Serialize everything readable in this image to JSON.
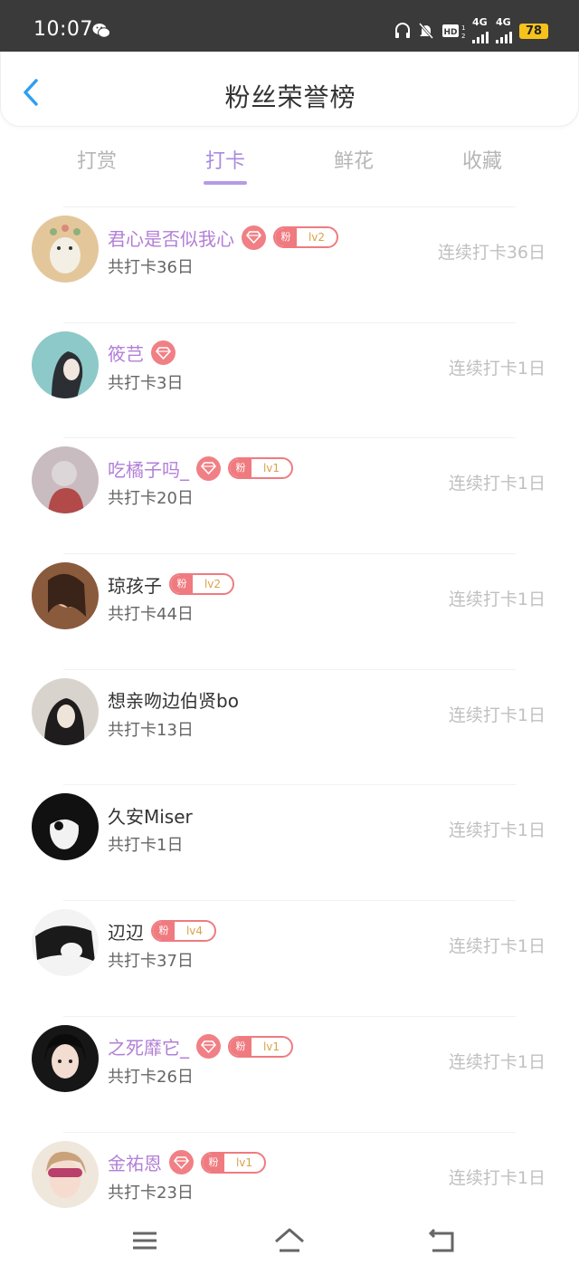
{
  "status_bar": {
    "time": "10:07",
    "net1": "4G",
    "net2": "4G",
    "hd": "HD",
    "battery": "78",
    "icons": [
      "wechat-icon",
      "headphones-icon",
      "mute-icon",
      "hd-icon",
      "signal-icon",
      "battery-icon"
    ]
  },
  "header": {
    "title": "粉丝荣誉榜",
    "back_icon": "chevron-left-icon"
  },
  "tabs": [
    {
      "label": "打赏",
      "active": false
    },
    {
      "label": "打卡",
      "active": true
    },
    {
      "label": "鲜花",
      "active": false
    },
    {
      "label": "收藏",
      "active": false
    }
  ],
  "colors": {
    "accent": "#a98be0",
    "vip_name": "#b27fd6",
    "badge": "#ef7b80",
    "level_text": "#d9a24a"
  },
  "fans": [
    {
      "name": "君心是否似我心",
      "vip": true,
      "gem": true,
      "fan_tag": "粉",
      "level": "lv2",
      "total": "共打卡36日",
      "streak": "连续打卡36日"
    },
    {
      "name": "筱芑",
      "vip": true,
      "gem": true,
      "fan_tag": "",
      "level": "",
      "total": "共打卡3日",
      "streak": "连续打卡1日"
    },
    {
      "name": "吃橘子吗_",
      "vip": true,
      "gem": true,
      "fan_tag": "粉",
      "level": "lv1",
      "total": "共打卡20日",
      "streak": "连续打卡1日"
    },
    {
      "name": "琼孩子",
      "vip": false,
      "gem": false,
      "fan_tag": "粉",
      "level": "lv2",
      "total": "共打卡44日",
      "streak": "连续打卡1日"
    },
    {
      "name": "想亲吻边伯贤bo",
      "vip": false,
      "gem": false,
      "fan_tag": "",
      "level": "",
      "total": "共打卡13日",
      "streak": "连续打卡1日"
    },
    {
      "name": "久安Miser",
      "vip": false,
      "gem": false,
      "fan_tag": "",
      "level": "",
      "total": "共打卡1日",
      "streak": "连续打卡1日"
    },
    {
      "name": "辺辺",
      "vip": false,
      "gem": false,
      "fan_tag": "粉",
      "level": "lv4",
      "total": "共打卡37日",
      "streak": "连续打卡1日"
    },
    {
      "name": "之死靡它_",
      "vip": true,
      "gem": true,
      "fan_tag": "粉",
      "level": "lv1",
      "total": "共打卡26日",
      "streak": "连续打卡1日"
    },
    {
      "name": "金祐恩",
      "vip": true,
      "gem": true,
      "fan_tag": "粉",
      "level": "lv1",
      "total": "共打卡23日",
      "streak": "连续打卡1日"
    }
  ],
  "navbar": {
    "icons": [
      "menu-icon",
      "home-icon",
      "back-icon"
    ]
  }
}
